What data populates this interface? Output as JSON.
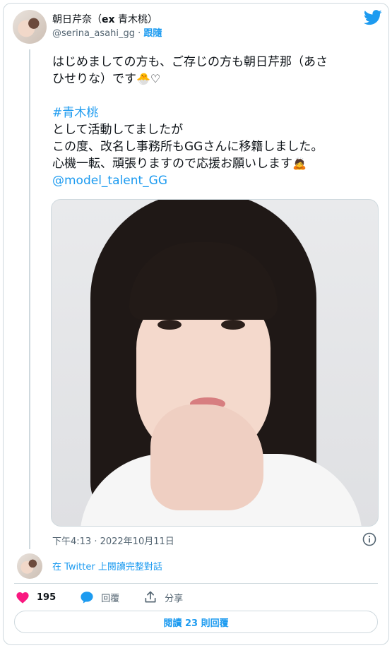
{
  "author": {
    "name_pre": "朝日芹奈（",
    "name_bold": "ex",
    "name_post": " 青木桃）",
    "handle": "@serina_asahi_gg",
    "separator": "·",
    "follow_label": "跟隨"
  },
  "tweet": {
    "line1": "はじめましての方も、ご存じの方も朝日芹那（あさ",
    "line2_text": "ひせりな）です",
    "line2_emoji": "🐣♡",
    "hashtag": "#青木桃",
    "line4": "として活動してましたが",
    "line5": "この度、改名し事務所もGGさんに移籍しました。",
    "line6_text": "心機一転、頑張りますので応援お願いします",
    "line6_emoji": "🙇",
    "mention": "@model_talent_GG"
  },
  "timestamp": "下午4:13 · 2022年10月11日",
  "read_conversation": "在 Twitter 上閱讀完整對話",
  "actions": {
    "likes": "195",
    "reply_label": "回覆",
    "share_label": "分享"
  },
  "read_replies": "閱讀 23 則回覆",
  "colors": {
    "accent": "#1d9bf0",
    "like": "#f91880",
    "text": "#0f1419",
    "muted": "#536471",
    "border": "#cfd9de"
  }
}
